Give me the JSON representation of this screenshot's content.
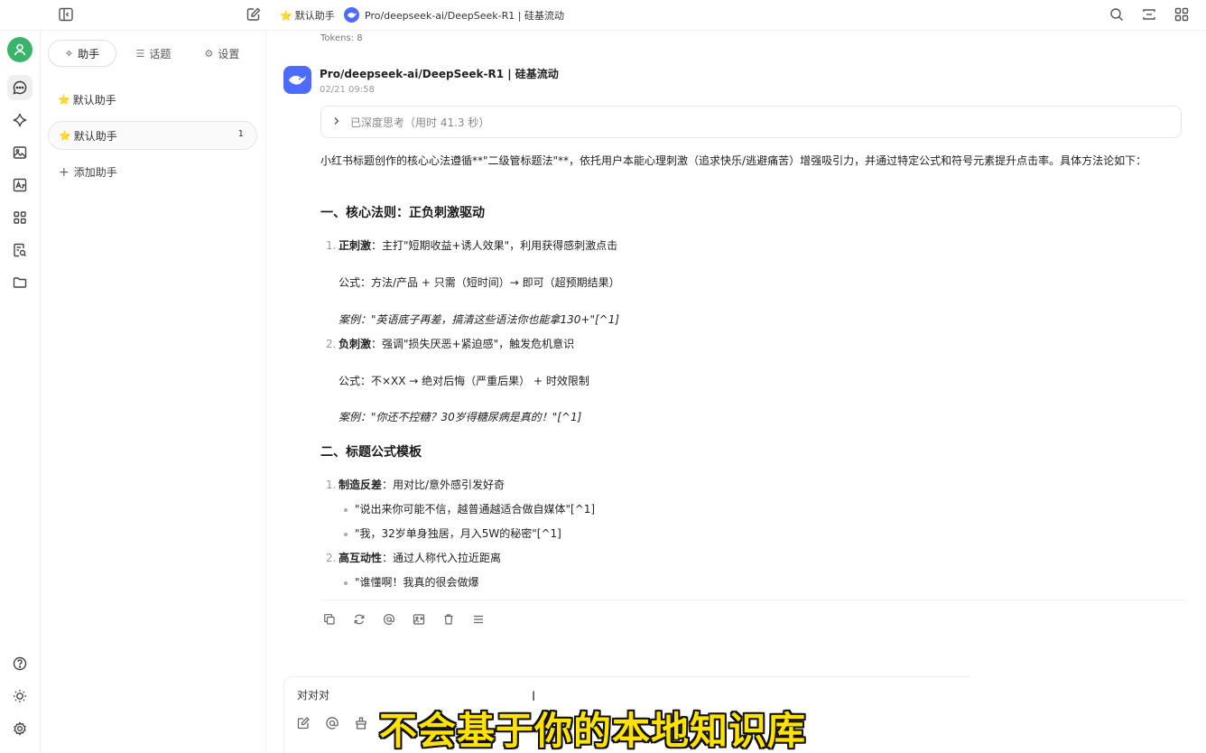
{
  "topbar": {
    "assistant_label": "默认助手",
    "model_title": "Pro/deepseek-ai/DeepSeek-R1 | 硅基流动"
  },
  "sidebar": {
    "tabs": [
      {
        "label": "助手",
        "icon": "sparkle-icon"
      },
      {
        "label": "话题",
        "icon": "list-icon"
      },
      {
        "label": "设置",
        "icon": "gear-icon"
      }
    ],
    "items": [
      {
        "label": "默认助手"
      },
      {
        "label": "默认助手",
        "count": "1"
      }
    ],
    "add_label": "添加助手"
  },
  "chat": {
    "tokens": "Tokens: 8",
    "model_name": "Pro/deepseek-ai/DeepSeek-R1 | 硅基流动",
    "time": "02/21 09:58",
    "thinking": "已深度思考（用时 41.3 秒）",
    "intro": "小红书标题创作的核心心法遵循**\"二级管标题法\"**，依托用户本能心理刺激（追求快乐/逃避痛苦）增强吸引力，并通过特定公式和符号元素提升点击率。具体方法论如下：",
    "h1": "一、核心法则：正负刺激驱动",
    "item1_num": "1.",
    "item1_title": "正刺激",
    "item1_text": "：主打\"短期收益+诱人效果\"，利用获得感刺激点击",
    "item1_formula": "公式：方法/产品 + 只需（短时间）→ 即可（超预期结果）",
    "item1_case": "案例：\"英语底子再差，搞清这些语法你也能拿130+\"[^1]",
    "item2_num": "2.",
    "item2_title": "负刺激",
    "item2_text": "：强调\"损失厌恶+紧迫感\"，触发危机意识",
    "item2_formula": "公式：不×XX → 绝对后悔（严重后果） + 时效限制",
    "item2_case": "案例：\"你还不控糖？30岁得糖尿病是真的！\"[^1]",
    "h2": "二、标题公式模板",
    "item3_num": "1.",
    "item3_title": "制造反差",
    "item3_text": "：用对比/意外感引发好奇",
    "item3_b1": "\"说出来你可能不信，越普通越适合做自媒体\"[^1]",
    "item3_b2": "\"我，32岁单身独居，月入5W的秘密\"[^1]",
    "item4_num": "2.",
    "item4_title": "高互动性",
    "item4_text": "：通过人称代入拉近距离",
    "item4_b1": "\"谁懂啊！我真的很会做爆"
  },
  "input": {
    "value": "对对对"
  },
  "subtitle": "不会基于你的本地知识库",
  "colors": {
    "avatar_green": "#3ab36b",
    "deepseek_blue": "#4d6bfe",
    "subtitle_yellow": "#ffe300"
  }
}
